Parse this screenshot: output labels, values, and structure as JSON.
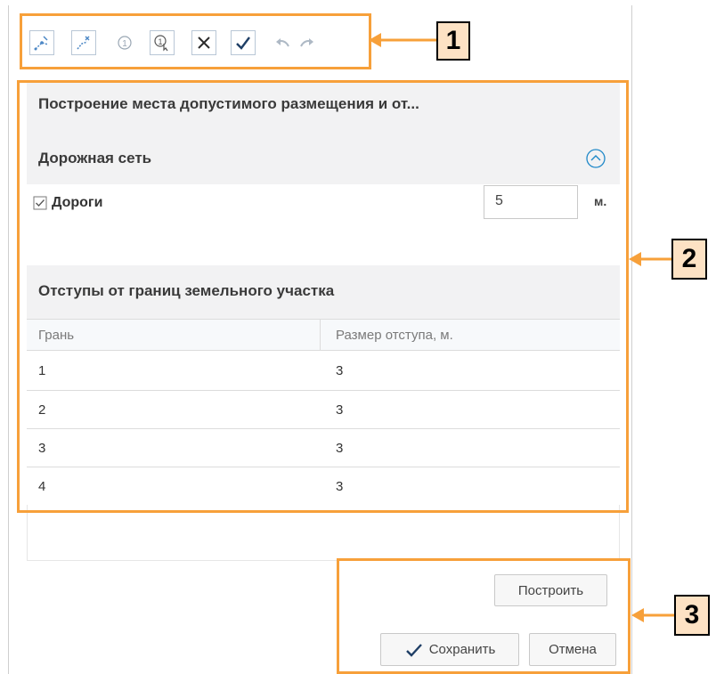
{
  "toolbar": {
    "icons": [
      "draw-line-icon",
      "edit-line-icon",
      "number-icon",
      "number-select-icon",
      "close-icon",
      "check-icon",
      "undo-icon",
      "redo-icon"
    ]
  },
  "form": {
    "title": "Построение места допустимого размещения и от...",
    "road_section": {
      "header": "Дорожная сеть",
      "checkbox_label": "Дороги",
      "checkbox_checked": true,
      "distance_value": "5",
      "distance_unit": "м."
    },
    "offsets_section": {
      "header": "Отступы от границ земельного участка",
      "columns": [
        "Грань",
        "Размер отступа, м."
      ],
      "rows": [
        {
          "edge": "1",
          "offset": "3"
        },
        {
          "edge": "2",
          "offset": "3"
        },
        {
          "edge": "3",
          "offset": "3"
        },
        {
          "edge": "4",
          "offset": "3"
        }
      ]
    }
  },
  "actions": {
    "build_label": "Построить",
    "save_label": "Сохранить",
    "cancel_label": "Отмена"
  },
  "callouts": [
    "1",
    "2",
    "3"
  ],
  "colors": {
    "highlight": "#f7a03a",
    "callout_fill": "#fde2c4",
    "accent": "#1e88c8"
  }
}
